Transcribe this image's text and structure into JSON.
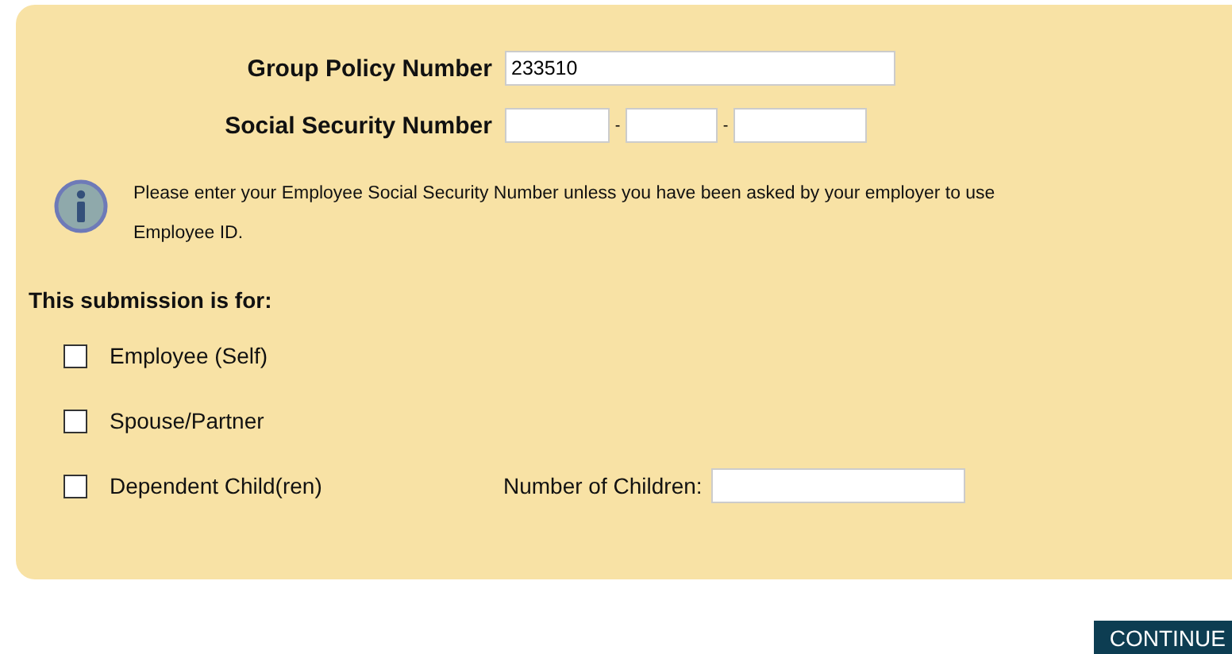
{
  "fields": [
    {
      "label": "Group Policy Number",
      "kind": "single",
      "value": "233510"
    },
    {
      "label": "Social Security Number",
      "kind": "ssn",
      "separators": [
        "-",
        "-"
      ]
    }
  ],
  "info": "Please enter your Employee Social Security Number unless you have been asked by your employer to use Employee ID.",
  "submission": {
    "heading": "This submission is for:",
    "options": [
      {
        "label": "Employee (Self)",
        "checked": false
      },
      {
        "label": "Spouse/Partner",
        "checked": false
      },
      {
        "label": "Dependent Child(ren)",
        "checked": false,
        "extra_label": "Number of Children:"
      }
    ]
  },
  "continue_button": "CONTINUE"
}
